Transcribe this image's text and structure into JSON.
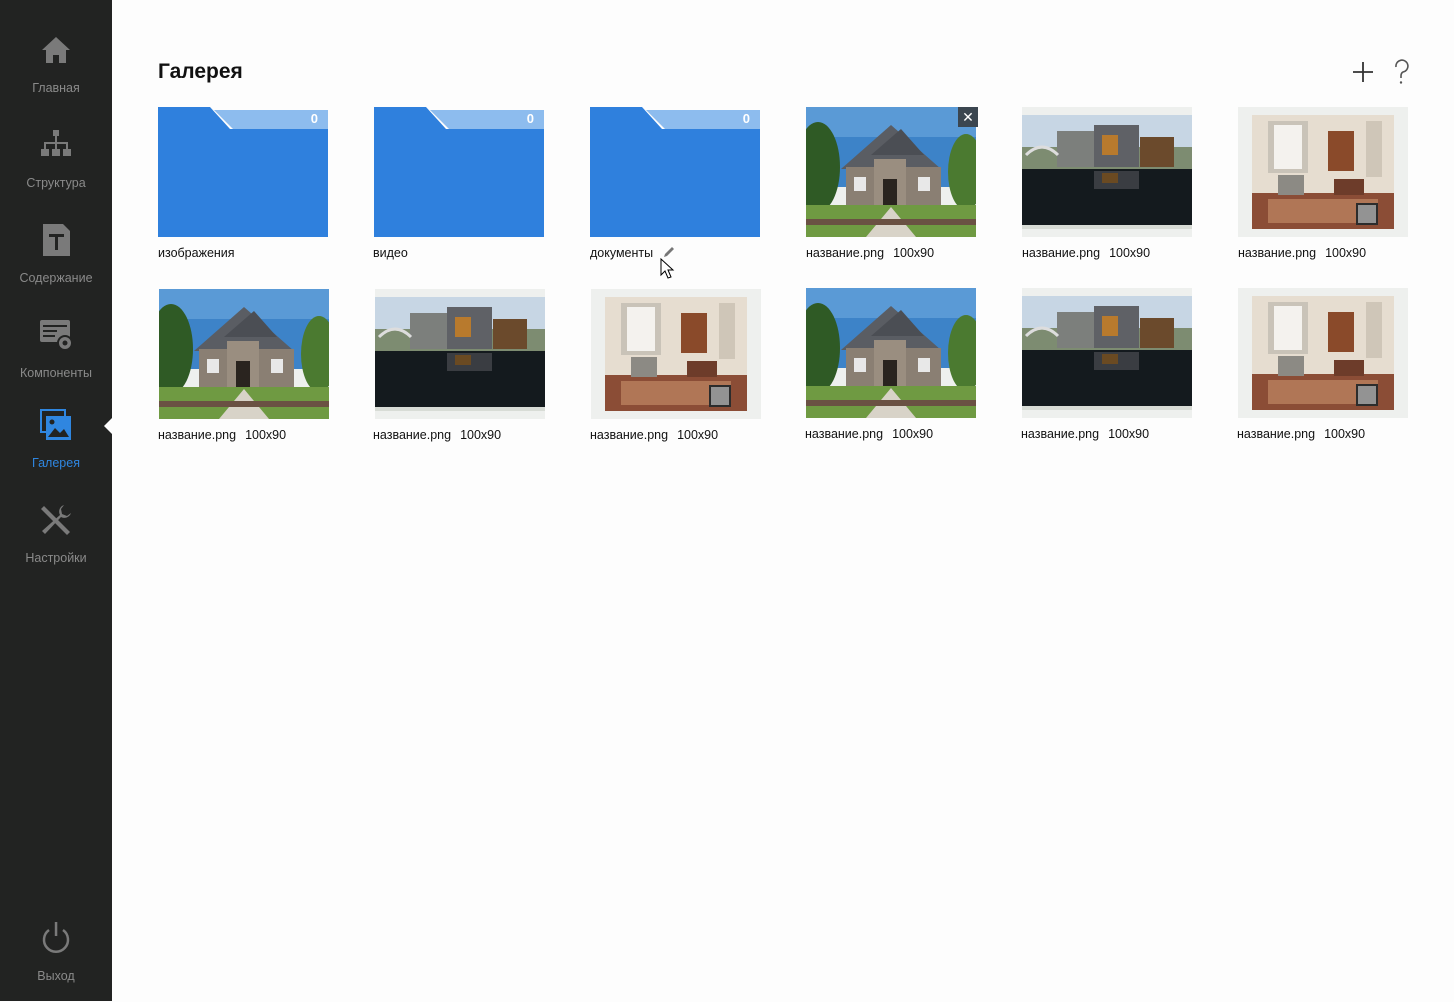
{
  "page": {
    "title": "Галерея"
  },
  "sidebar": {
    "items": [
      {
        "label": "Главная",
        "icon": "home-icon",
        "active": false
      },
      {
        "label": "Структура",
        "icon": "structure-icon",
        "active": false
      },
      {
        "label": "Содержание",
        "icon": "text-document-icon",
        "active": false
      },
      {
        "label": "Компоненты",
        "icon": "components-gear-icon",
        "active": false
      },
      {
        "label": "Галерея",
        "icon": "gallery-icon",
        "active": true
      },
      {
        "label": "Настройки",
        "icon": "tools-icon",
        "active": false
      }
    ],
    "logout": {
      "label": "Выход",
      "icon": "power-icon"
    }
  },
  "toolbar": {
    "add_icon": "plus-icon",
    "help_icon": "question-icon"
  },
  "folders": [
    {
      "name": "изображения",
      "count": "0"
    },
    {
      "name": "видео",
      "count": "0"
    },
    {
      "name": "документы",
      "count": "0"
    }
  ],
  "images": [
    {
      "name": "название.png",
      "dims": "100x90",
      "scene": "house"
    },
    {
      "name": "название.png",
      "dims": "100x90",
      "scene": "lake"
    },
    {
      "name": "название.png",
      "dims": "100x90",
      "scene": "room"
    },
    {
      "name": "название.png",
      "dims": "100x90",
      "scene": "house"
    },
    {
      "name": "название.png",
      "dims": "100x90",
      "scene": "lake"
    },
    {
      "name": "название.png",
      "dims": "100x90",
      "scene": "room"
    },
    {
      "name": "название.png",
      "dims": "100x90",
      "scene": "house"
    },
    {
      "name": "название.png",
      "dims": "100x90",
      "scene": "lake"
    },
    {
      "name": "название.png",
      "dims": "100x90",
      "scene": "room"
    }
  ],
  "colors": {
    "sidebar_bg": "#222322",
    "accent": "#2f86e0",
    "folder_blue": "#2f80dd",
    "folder_tab": "#8dbcee"
  }
}
